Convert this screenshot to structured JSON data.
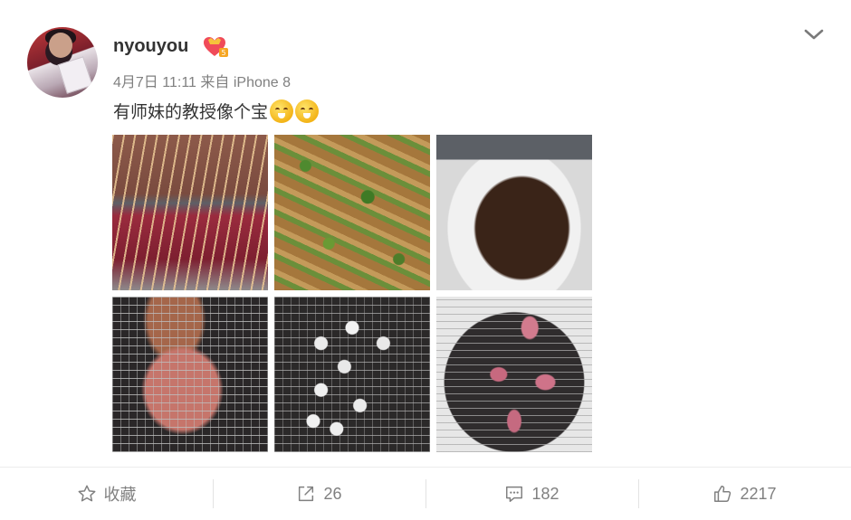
{
  "post": {
    "user": {
      "name": "nyouyou"
    },
    "meta": {
      "date": "4月7日",
      "time": "11:11",
      "source": "来自 iPhone 8"
    },
    "text": "有师妹的教授像个宝",
    "icons": [
      "avatar-photo",
      "vip-heart-icon",
      "chevron-down-icon",
      "grin-emoji",
      "grin-emoji"
    ],
    "photos": [
      "grilled-skewers-1",
      "herbed-chicken-wings",
      "grilled-beef-strips",
      "meat-skewers-on-grill",
      "white-items-on-grill",
      "octopus-on-grill"
    ]
  },
  "actions": {
    "favorite_label": "收藏",
    "share_count": "26",
    "comment_count": "182",
    "like_count": "2217"
  },
  "colors": {
    "meta_gray": "#808080",
    "text": "#333333",
    "divider": "#e3e3e3"
  }
}
